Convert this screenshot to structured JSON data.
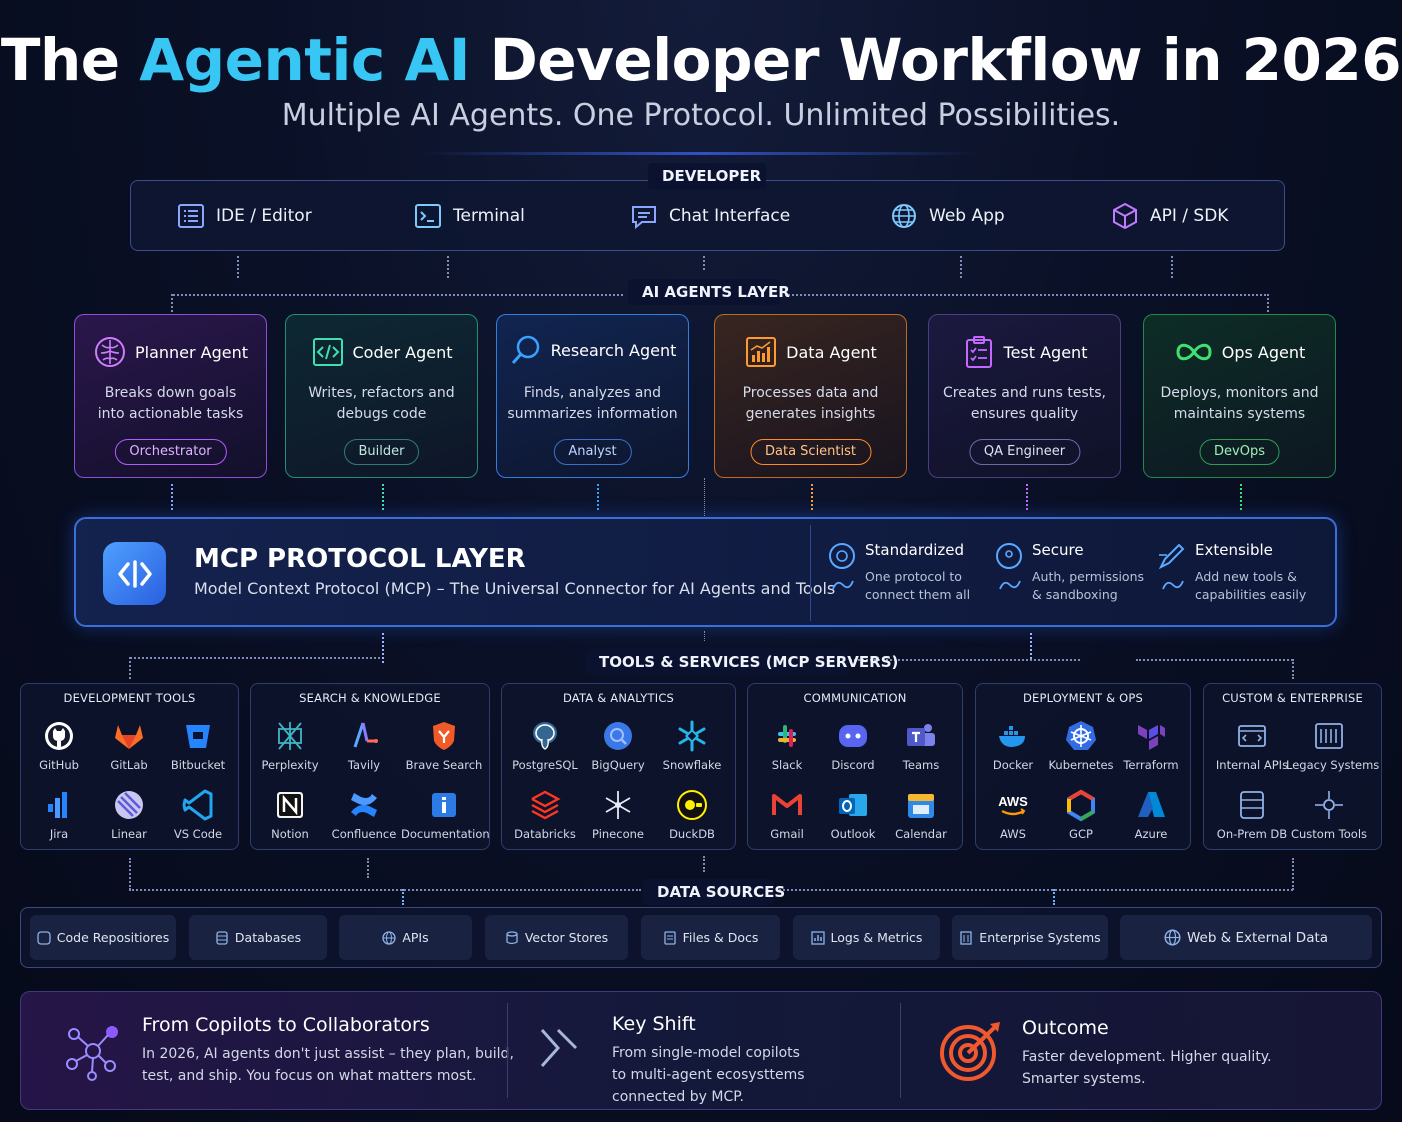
{
  "header": {
    "title_pre": "The ",
    "title_accent": "Agentic AI",
    "title_post": " Developer Workflow in 2026",
    "subtitle": "Multiple AI Agents. One Protocol. Unlimited Possibilities."
  },
  "developer": {
    "label": "DEVELOPER",
    "items": [
      {
        "label": "IDE / Editor",
        "icon": "ide-icon"
      },
      {
        "label": "Terminal",
        "icon": "terminal-icon"
      },
      {
        "label": "Chat Interface",
        "icon": "chat-icon"
      },
      {
        "label": "Web App",
        "icon": "globe-icon"
      },
      {
        "label": "API / SDK",
        "icon": "cube-icon"
      }
    ]
  },
  "agents": {
    "label": "AI AGENTS LAYER",
    "cards": [
      {
        "title": "Planner Agent",
        "desc1": "Breaks down goals",
        "desc2": "into actionable tasks",
        "badge": "Orchestrator",
        "color": "#c070ff",
        "icon": "brain-icon"
      },
      {
        "title": "Coder Agent",
        "desc1": "Writes, refactors and",
        "desc2": "debugs code",
        "badge": "Builder",
        "color": "#3fe0b0",
        "icon": "code-icon"
      },
      {
        "title": "Research Agent",
        "desc1": "Finds, analyzes and",
        "desc2": "summarizes information",
        "badge": "Analyst",
        "color": "#3aa0ff",
        "icon": "search-icon"
      },
      {
        "title": "Data Agent",
        "desc1": "Processes data and",
        "desc2": "generates insights",
        "badge": "Data Scientist",
        "color": "#ff9a2e",
        "icon": "chart-icon"
      },
      {
        "title": "Test Agent",
        "desc1": "Creates and runs tests,",
        "desc2": "ensures quality",
        "badge": "QA Engineer",
        "color": "#c468ff",
        "icon": "clipboard-check-icon"
      },
      {
        "title": "Ops Agent",
        "desc1": "Deploys, monitors and",
        "desc2": "maintains systems",
        "badge": "DevOps",
        "color": "#3fe070",
        "icon": "infinity-icon"
      }
    ]
  },
  "mcp": {
    "title": "MCP PROTOCOL LAYER",
    "subtitle": "Model Context Protocol (MCP) – The Universal Connector for AI Agents and Tools",
    "features": [
      {
        "title": "Standardized",
        "desc1": "One protocol to",
        "desc2": "connect them all"
      },
      {
        "title": "Secure",
        "desc1": "Auth, permissions",
        "desc2": "& sandboxing"
      },
      {
        "title": "Extensible",
        "desc1": "Add new tools &",
        "desc2": "capabilities easily"
      }
    ]
  },
  "tools": {
    "label": "TOOLS & SERVICES (MCP SERVERS)",
    "groups": [
      {
        "title": "DEVELOPMENT TOOLS",
        "items": [
          "GitHub",
          "GitLab",
          "Bitbucket",
          "Jira",
          "Linear",
          "VS Code"
        ]
      },
      {
        "title": "SEARCH & KNOWLEDGE",
        "items": [
          "Perplexity",
          "Tavily",
          "Brave Search",
          "Notion",
          "Confluence",
          "Documentation"
        ]
      },
      {
        "title": "DATA & ANALYTICS",
        "items": [
          "PostgreSQL",
          "BigQuery",
          "Snowflake",
          "Databricks",
          "Pinecone",
          "DuckDB"
        ]
      },
      {
        "title": "COMMUNICATION",
        "items": [
          "Slack",
          "Discord",
          "Teams",
          "Gmail",
          "Outlook",
          "Calendar"
        ]
      },
      {
        "title": "DEPLOYMENT & OPS",
        "items": [
          "Docker",
          "Kubernetes",
          "Terraform",
          "AWS",
          "GCP",
          "Azure"
        ]
      },
      {
        "title": "CUSTOM & ENTERPRISE",
        "items": [
          "Internal APIs",
          "Legacy Systems",
          "On-Prem DB",
          "Custom Tools"
        ]
      }
    ],
    "aws_mark": "AWS"
  },
  "data_sources": {
    "label": "DATA SOURCES",
    "items": [
      "Code Repositiores",
      "Databases",
      "APIs",
      "Vector Stores",
      "Files & Docs",
      "Logs & Metrics",
      "Enterprise Systems",
      "Web & External Data"
    ]
  },
  "bottom": {
    "panels": [
      {
        "title": "From Copilots to Collaborators",
        "line1": "In 2026, AI agents don't just assist – they plan, build,",
        "line2": "test, and ship. You focus on what matters most."
      },
      {
        "title": "Key Shift",
        "line1": "From single-model copilots",
        "line2": "to multi-agent ecosysttems",
        "line3": "connected by MCP."
      },
      {
        "title": "Outcome",
        "line1": "Faster development. Higher quality.",
        "line2": "Smarter systems."
      }
    ]
  },
  "colors": {
    "accent": "#38c6f4",
    "mcp_border": "#3a6fd8"
  }
}
